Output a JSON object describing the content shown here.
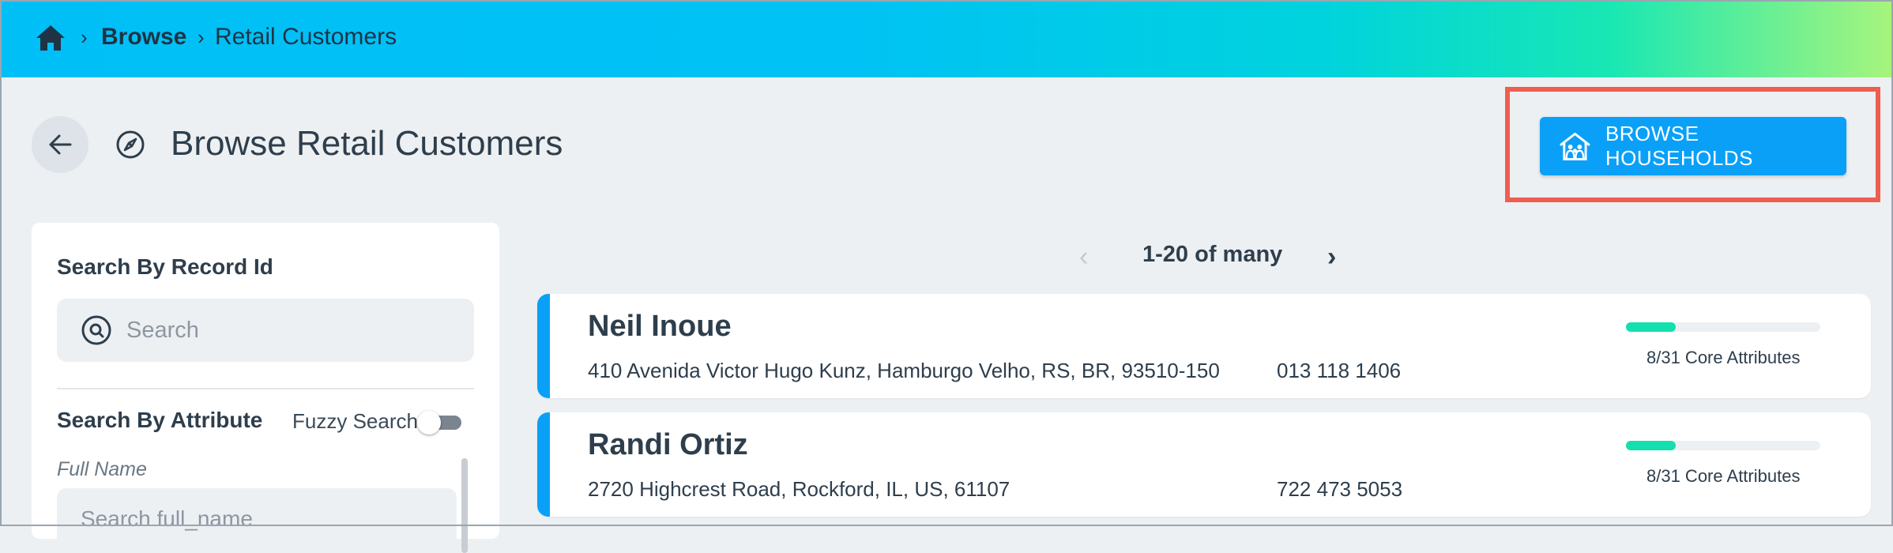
{
  "breadcrumb": {
    "home_icon": "home-icon",
    "items": [
      "Browse",
      "Retail Customers"
    ],
    "separator": "›"
  },
  "page": {
    "title": "Browse Retail Customers",
    "back_icon": "arrow-left-icon",
    "title_icon": "compass-icon"
  },
  "actions": {
    "browse_households_label": "BROWSE HOUSEHOLDS",
    "browse_households_icon": "house-people-icon"
  },
  "filters": {
    "record_id_heading": "Search By Record Id",
    "record_id_placeholder": "Search",
    "attribute_heading": "Search By Attribute",
    "fuzzy_label": "Fuzzy Search",
    "fuzzy_enabled": false,
    "full_name_label": "Full Name",
    "full_name_placeholder": "Search full_name"
  },
  "pagination": {
    "range_text": "1-20 of many",
    "prev_glyph": "‹",
    "next_glyph": "›"
  },
  "records": [
    {
      "name": "Neil Inoue",
      "address": "410 Avenida Victor Hugo Kunz, Hamburgo Velho, RS, BR, 93510-150",
      "phone": "013 118 1406",
      "core_attributes": "8/31 Core Attributes",
      "completeness": 0.258
    },
    {
      "name": "Randi Ortiz",
      "address": "2720 Highcrest Road, Rockford, IL, US, 61107",
      "phone": "722 473 5053",
      "core_attributes": "8/31 Core Attributes",
      "completeness": 0.258
    }
  ],
  "colors": {
    "accent": "#0aa0f8",
    "progress": "#14dfae",
    "highlight": "#ef5d4f"
  }
}
